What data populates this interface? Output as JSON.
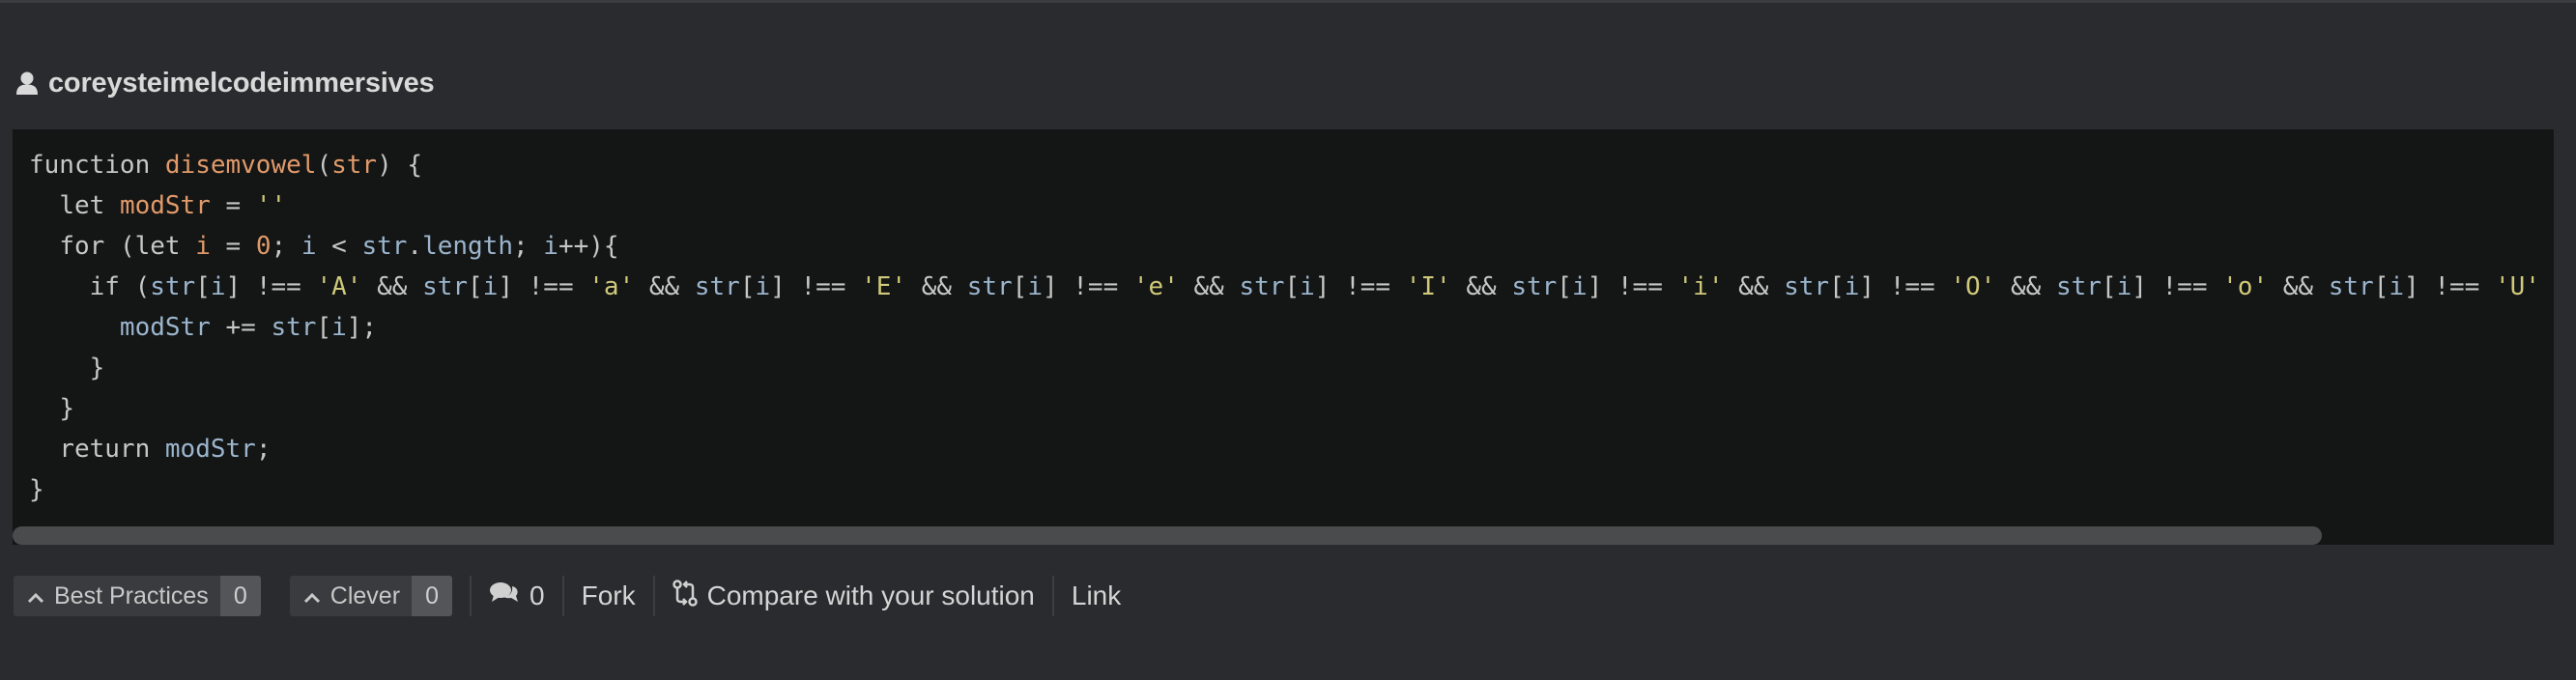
{
  "author": {
    "username": "coreysteimelcodeimmersives"
  },
  "code_lines": [
    "function disemvowel(str) {",
    "  let modStr = ''",
    "  for (let i = 0; i < str.length; i++){",
    "    if (str[i] !== 'A' && str[i] !== 'a' && str[i] !== 'E' && str[i] !== 'e' && str[i] !== 'I' && str[i] !== 'i' && str[i] !== 'O' && str[i] !== 'o' && str[i] !== 'U' && ",
    "      modStr += str[i];",
    "    }",
    "  }",
    "  return modStr;",
    "}"
  ],
  "actions": {
    "best_practices": {
      "label": "Best Practices",
      "count": "0"
    },
    "clever": {
      "label": "Clever",
      "count": "0"
    },
    "comments": {
      "count": "0"
    },
    "fork": "Fork",
    "compare": "Compare with your solution",
    "link": "Link"
  },
  "icons": {
    "user": "user-icon",
    "upvote": "chevron-up-icon",
    "comments": "comments-icon",
    "compare": "compare-icon"
  },
  "colors": {
    "background": "#2a2b2e",
    "code_background": "#141515",
    "keyword": "#c5c8c6",
    "function_name": "#e09a6a",
    "identifier": "#9bb5cd",
    "string": "#cfc97a"
  }
}
